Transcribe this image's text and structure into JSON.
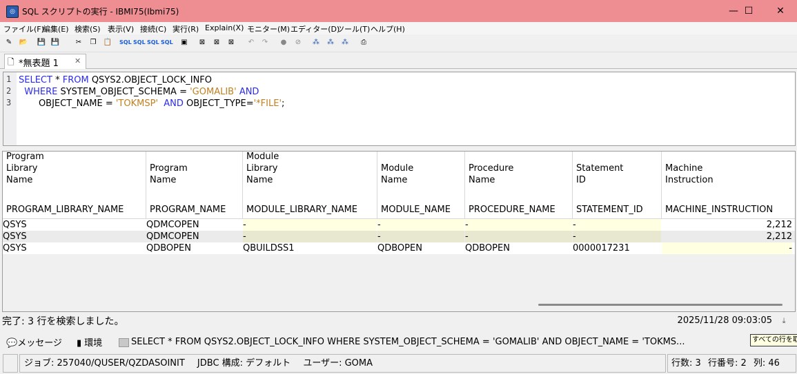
{
  "window": {
    "title": "SQL スクリプトの実行 - IBMI75(Ibmi75)",
    "minimize": "—",
    "maximize": "☐",
    "close": "✕"
  },
  "menu": [
    "ファイル(F)",
    "編集(E)",
    "検索(S)",
    "表示(V)",
    "接続(C)",
    "実行(R)",
    "Explain(X)",
    "モニター(M)",
    "エディター(D)",
    "ツール(T)",
    "ヘルプ(H)"
  ],
  "toolbar": {
    "icons": [
      "new-script-icon",
      "open-icon",
      "save-icon",
      "save-as-icon",
      "cut-icon",
      "copy-icon",
      "paste-icon",
      "run-sql-icon",
      "run-all-icon",
      "run-selected-icon",
      "run-to-end-icon",
      "format-icon",
      "explain-icon",
      "visual-explain-icon",
      "analyze-icon",
      "undo-icon",
      "redo-icon",
      "stop-icon",
      "cancel-icon",
      "monitor-start-icon",
      "monitor-stop-icon",
      "monitor-analyze-icon",
      "print-icon"
    ],
    "sql_label": "SQL"
  },
  "tab": {
    "label": "*無表題 1",
    "close": "✕"
  },
  "editor": {
    "line_numbers": [
      "1",
      "2",
      "3"
    ],
    "line1": {
      "kw1": "SELECT",
      "t1": " * ",
      "kw2": "FROM",
      "t2": " QSYS2.OBJECT_LOCK_INFO"
    },
    "line2": {
      "indent": "  ",
      "kw1": "WHERE",
      "t1": " SYSTEM_OBJECT_SCHEMA = ",
      "s1": "'GOMALIB'",
      "kw2": "AND"
    },
    "line3": {
      "indent": "       ",
      "t1": "OBJECT_NAME = ",
      "s1": "'TOKMSP'",
      "kw1": "AND",
      "t2": " OBJECT_TYPE=",
      "s2": "'*FILE'",
      "t3": ";"
    }
  },
  "results": {
    "columns": [
      {
        "label": "Program\nLibrary\nName",
        "sys": "PROGRAM_LIBRARY_NAME"
      },
      {
        "label": "Program\nName",
        "sys": "PROGRAM_NAME"
      },
      {
        "label": "Module\nLibrary\nName",
        "sys": "MODULE_LIBRARY_NAME"
      },
      {
        "label": "Module\nName",
        "sys": "MODULE_NAME"
      },
      {
        "label": "Procedure\nName",
        "sys": "PROCEDURE_NAME"
      },
      {
        "label": "Statement\nID",
        "sys": "STATEMENT_ID"
      },
      {
        "label": "Machine\nInstruction",
        "sys": "MACHINE_INSTRUCTION"
      }
    ],
    "rows": [
      [
        "QSYS",
        "QDMCOPEN",
        "-",
        "-",
        "-",
        "-",
        "2,212"
      ],
      [
        "QSYS",
        "QDMCOPEN",
        "-",
        "-",
        "-",
        "-",
        "2,212"
      ],
      [
        "QSYS",
        "QDBOPEN",
        "QBUILDSS1",
        "QDBOPEN",
        "QDBOPEN",
        "0000017231",
        "-"
      ]
    ]
  },
  "status": {
    "message": "完了: 3 行を検索しました。",
    "timestamp": "2025/11/28 09:03:05"
  },
  "bottom_tabs": {
    "messages": "メッセージ",
    "environment": "環境",
    "sql": "SELECT * FROM QSYS2.OBJECT_LOCK_INFO WHERE SYSTEM_OBJECT_SCHEMA = 'GOMALIB' AND OBJECT_NAME = 'TOKMS...",
    "tooltip": "すべての行を取"
  },
  "statusbar": {
    "job": "ジョブ: 257040/QUSER/QZDASOINIT",
    "jdbc": "JDBC 構成: デフォルト",
    "user": "ユーザー: GOMA",
    "rows": "行数: 3",
    "line": "行番号: 2",
    "col": "列: 46"
  },
  "colors": {
    "titlebar": "#ee8e92",
    "keyword": "#2a2af0",
    "string": "#c08020",
    "row_highlight": "#ffffe1",
    "row_shade": "#e8e8d0"
  }
}
